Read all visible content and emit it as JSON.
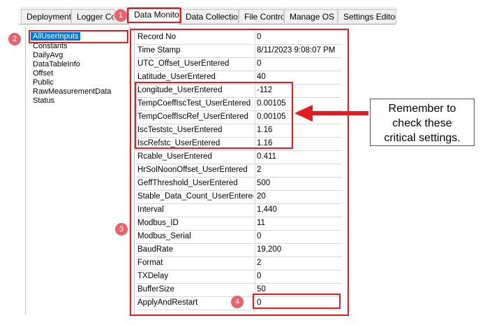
{
  "tabs": [
    {
      "label": "Deployment"
    },
    {
      "label": "Logger Con"
    },
    {
      "label": "Data Monitor"
    },
    {
      "label": "Data Collection"
    },
    {
      "label": "File Control"
    },
    {
      "label": "Manage OS ★"
    },
    {
      "label": "Settings Editor"
    }
  ],
  "tables": [
    {
      "label": "AllUserInputs"
    },
    {
      "label": "Constants"
    },
    {
      "label": "DailyAvg"
    },
    {
      "label": "DataTableInfo"
    },
    {
      "label": "Offset"
    },
    {
      "label": "Public"
    },
    {
      "label": "RawMeasurementData"
    },
    {
      "label": "Status"
    }
  ],
  "rows": [
    {
      "name": "Record No",
      "value": "0"
    },
    {
      "name": "Time Stamp",
      "value": "8/11/2023 9:08:07 PM"
    },
    {
      "name": "UTC_Offset_UserEntered",
      "value": "0"
    },
    {
      "name": "Latitude_UserEntered",
      "value": "40"
    },
    {
      "name": "Longitude_UserEntered",
      "value": "-112"
    },
    {
      "name": "TempCoeffIscTest_UserEntered",
      "value": "0.00105"
    },
    {
      "name": "TempCoeffIscRef_UserEntered",
      "value": "0.00105"
    },
    {
      "name": "IscTeststc_UserEntered",
      "value": "1.16"
    },
    {
      "name": "IscRefstc_UserEntered",
      "value": "1.16"
    },
    {
      "name": "Rcable_UserEntered",
      "value": "0.411"
    },
    {
      "name": "HrSolNoonOffset_UserEntered",
      "value": "2"
    },
    {
      "name": "GeffThreshold_UserEntered",
      "value": "500"
    },
    {
      "name": "Stable_Data_Count_UserEntered",
      "value": "20"
    },
    {
      "name": "Interval",
      "value": "1,440"
    },
    {
      "name": "Modbus_ID",
      "value": "11"
    },
    {
      "name": "Modbus_Serial",
      "value": "0"
    },
    {
      "name": "BaudRate",
      "value": "19,200"
    },
    {
      "name": "Format",
      "value": "2"
    },
    {
      "name": "TXDelay",
      "value": "0"
    },
    {
      "name": "BufferSize",
      "value": "50"
    },
    {
      "name": "ApplyAndRestart",
      "value": "0"
    }
  ],
  "badges": [
    "1",
    "2",
    "3",
    "4"
  ],
  "callout": {
    "line1": "Remember to",
    "line2": "check these",
    "line3": "critical settings."
  },
  "colors": {
    "annotation_red": "#e31b23",
    "badge": "#e8636b",
    "selection": "#0078d7"
  }
}
